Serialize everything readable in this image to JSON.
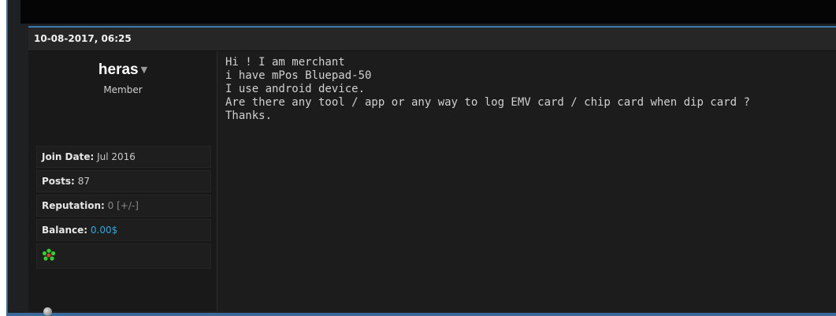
{
  "post": {
    "date": "10-08-2017, 06:25",
    "username": "heras",
    "user_title": "Member",
    "stats": {
      "join_label": "Join Date:",
      "join_value": "Jul 2016",
      "posts_label": "Posts:",
      "posts_value": "87",
      "reputation_label": "Reputation:",
      "reputation_value": "0",
      "reputation_vote": "[+/-]",
      "balance_label": "Balance:",
      "balance_value": "0.00$"
    },
    "icons": {
      "flower": "icq-flower-icon",
      "status": "offline-status-icon"
    },
    "message_lines": [
      "Hi ! I am merchant",
      "i have mPos Bluepad-50",
      "I use android device.",
      "Are there any tool / app or any way to log EMV card / chip card when dip card ?",
      "Thanks."
    ],
    "colors": {
      "accent": "#3d7ab4",
      "balance": "#29a8e0",
      "flower": "#2fd12f"
    }
  }
}
